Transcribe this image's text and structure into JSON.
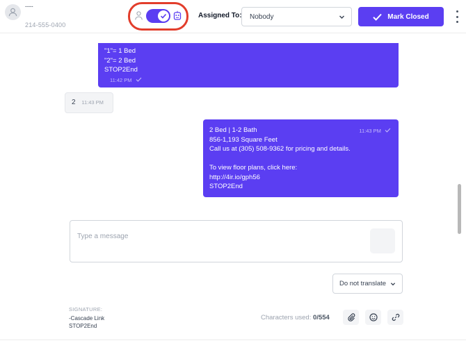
{
  "contact": {
    "name": "......",
    "phone": "214-555-0400"
  },
  "header": {
    "assigned_label": "Assigned To:",
    "assigned_value": "Nobody",
    "mark_closed_label": "Mark Closed"
  },
  "messages": [
    {
      "direction": "outgoing",
      "lines": [
        "\"1\"= 1 Bed",
        "\"2\"= 2 Bed",
        "STOP2End"
      ],
      "time": "11:42 PM"
    },
    {
      "direction": "incoming",
      "text": "2",
      "time": "11:43 PM"
    },
    {
      "direction": "outgoing",
      "lines": [
        "2 Bed | 1-2 Bath",
        "856-1,193 Square Feet",
        "Call us at (305) 508-9362 for pricing and details.",
        "",
        "To view floor plans, click here:",
        "http://4ir.io/gph56",
        "STOP2End"
      ],
      "time": "11:43 PM"
    }
  ],
  "composer": {
    "placeholder": "Type a message"
  },
  "translate": {
    "label": "Do not translate"
  },
  "signature": {
    "label": "SIGNATURE:",
    "line1": "-Cascade Link",
    "line2": "STOP2End"
  },
  "characters": {
    "label": "Characters used:",
    "value": "0/554"
  },
  "colors": {
    "accent": "#5b3ef2",
    "highlight": "#e23d2b"
  }
}
